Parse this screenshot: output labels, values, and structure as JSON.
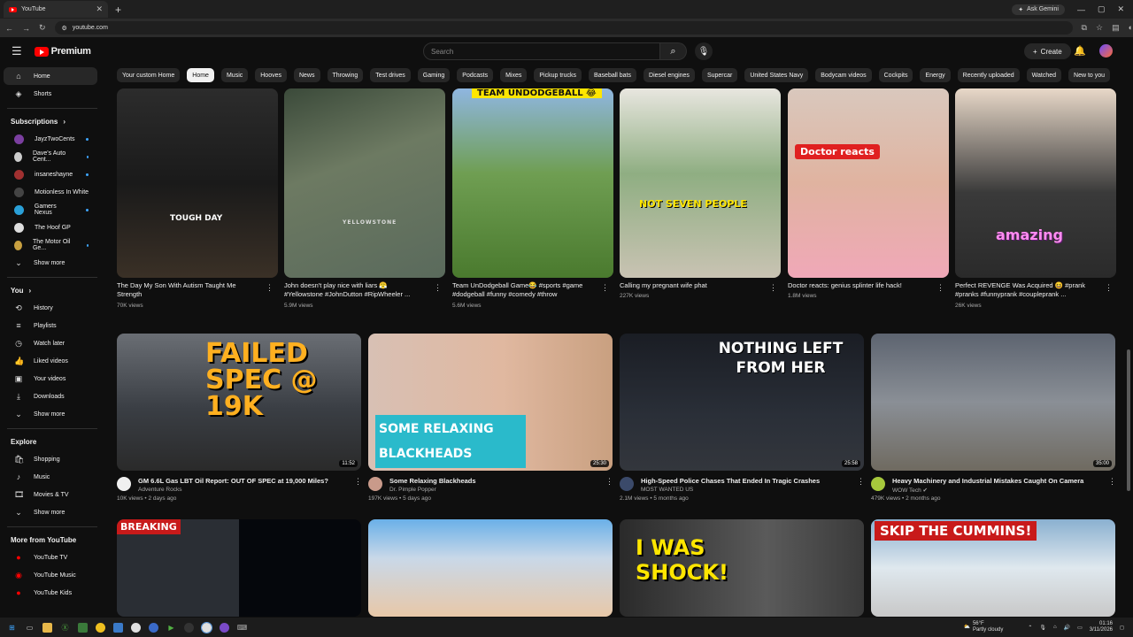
{
  "browser": {
    "tab_title": "YouTube",
    "url": "youtube.com",
    "gemini_label": "Ask Gemini"
  },
  "header": {
    "logo_text": "Premium",
    "search_placeholder": "Search",
    "create_label": "Create"
  },
  "chips": [
    "Your custom Home",
    "Home",
    "Music",
    "Hooves",
    "News",
    "Throwing",
    "Test drives",
    "Gaming",
    "Podcasts",
    "Mixes",
    "Pickup trucks",
    "Baseball bats",
    "Diesel engines",
    "Supercar",
    "United States Navy",
    "Bodycam videos",
    "Cockpits",
    "Energy",
    "Recently uploaded",
    "Watched",
    "New to you"
  ],
  "sidebar": {
    "home": "Home",
    "shorts": "Shorts",
    "subscriptions_head": "Subscriptions",
    "subscriptions": [
      "JayzTwoCents",
      "Dave's Auto Cent...",
      "insaneshayne",
      "Motionless In White",
      "Gamers Nexus",
      "The Hoof GP",
      "The Motor Oil Ge..."
    ],
    "show_more": "Show more",
    "you_head": "You",
    "you_items": [
      "History",
      "Playlists",
      "Watch later",
      "Liked videos",
      "Your videos",
      "Downloads"
    ],
    "explore_head": "Explore",
    "explore_items": [
      "Shopping",
      "Music",
      "Movies & TV"
    ],
    "more_head": "More from YouTube",
    "more_items": [
      "YouTube TV",
      "YouTube Music",
      "YouTube Kids"
    ]
  },
  "shorts": [
    {
      "title": "The Day My Son With Autism Taught Me Strength",
      "views": "70K views",
      "overlay": "TOUGH DAY"
    },
    {
      "title": "John doesn't play nice with liars 😤 #Yellowstone #JohnDutton #RipWheeler ...",
      "views": "5.9M views",
      "overlay": "YELLOWSTONE"
    },
    {
      "title": "Team UnDodgeball Game😂 #sports #game #dodgeball #funny #comedy #throw",
      "views": "5.6M views",
      "overlay": "TEAM UNDODGEBALL 😂"
    },
    {
      "title": "Calling my pregnant wife phat",
      "views": "227K views",
      "overlay": "NOT SEVEN PEOPLE"
    },
    {
      "title": "Doctor reacts: genius splinter life hack!",
      "views": "1.8M views",
      "overlay": "Doctor reacts"
    },
    {
      "title": "Perfect REVENGE Was Acquired 😆 #prank #pranks #funnyprank #coupleprank ...",
      "views": "26K views",
      "overlay": "amazing"
    }
  ],
  "videos": [
    {
      "title": "GM 6.6L Gas LBT Oil Report: OUT OF SPEC at 19,000 Miles?",
      "channel": "Adventure Rocks",
      "meta": "10K views • 2 days ago",
      "duration": "11:52",
      "overlay": "FAILED SPEC @ 19K"
    },
    {
      "title": "Some Relaxing Blackheads",
      "channel": "Dr. Pimple Popper",
      "meta": "197K views • 5 days ago",
      "duration": "25:30",
      "overlay": "SOME RELAXING BLACKHEADS"
    },
    {
      "title": "High-Speed Police Chases That Ended In Tragic Crashes",
      "channel": "MOST WANTED US",
      "meta": "2.1M views • 5 months ago",
      "duration": "25:58",
      "overlay": "NOTHING LEFT FROM HER"
    },
    {
      "title": "Heavy Machinery and Industrial Mistakes Caught On Camera",
      "channel": "WOW Tech ✔",
      "meta": "479K views • 2 months ago",
      "duration": "35:00",
      "overlay": ""
    }
  ],
  "row3": [
    {
      "overlay": "BREAKING"
    },
    {
      "overlay": ""
    },
    {
      "overlay": "I WAS SHOCK!"
    },
    {
      "overlay": "SKIP THE CUMMINS!"
    }
  ],
  "taskbar": {
    "weather_temp": "56°F",
    "weather_desc": "Partly cloudy",
    "time": "01:16",
    "date": "3/11/2026"
  },
  "colors": {
    "accent": "#ff0000",
    "bg": "#0f0f0f",
    "chip": "#272727"
  }
}
